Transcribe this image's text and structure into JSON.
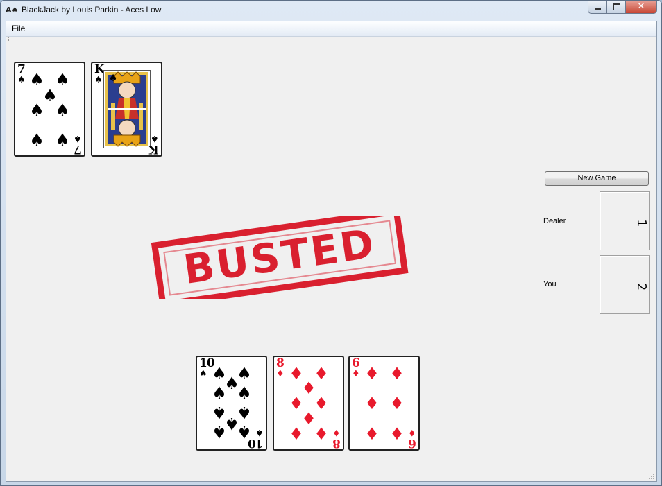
{
  "window": {
    "title": "BlackJack by Louis Parkin - Aces Low",
    "app_icon": "A♠",
    "caption": {
      "minimize": "minimize-icon",
      "maximize": "maximize-icon",
      "close_glyph": "✕"
    }
  },
  "menu": {
    "file": "File"
  },
  "dealer_hand": [
    {
      "rank": "7",
      "suit": "♠",
      "color": "#000000"
    },
    {
      "rank": "K",
      "suit": "♠",
      "color": "#000000"
    }
  ],
  "player_hand": [
    {
      "rank": "10",
      "suit": "♦",
      "color": "#000000",
      "suit_display": "♠"
    },
    {
      "rank": "8",
      "suit": "♦",
      "color": "#e8192c"
    },
    {
      "rank": "6",
      "suit": "♦",
      "color": "#e8192c"
    }
  ],
  "status": {
    "text": "BUSTED",
    "color": "#d9202f"
  },
  "controls": {
    "new_game": "New Game"
  },
  "scores": {
    "dealer_label": "Dealer",
    "dealer_value": "1",
    "you_label": "You",
    "you_value": "2"
  }
}
